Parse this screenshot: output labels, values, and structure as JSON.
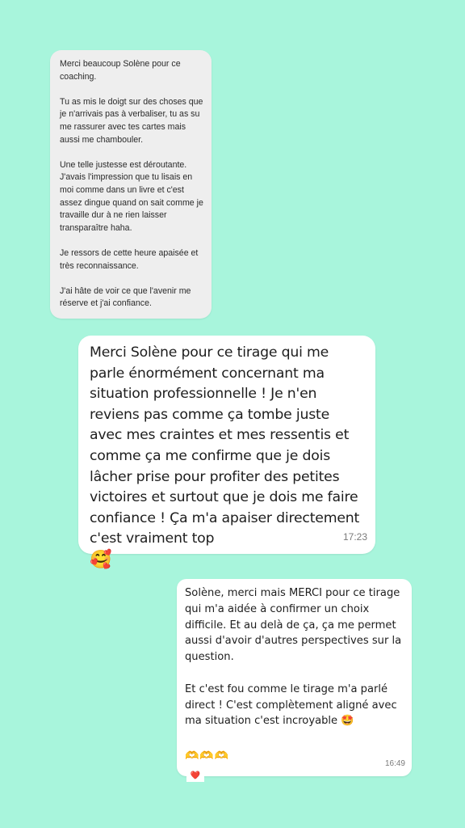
{
  "background_color": "#a8f5dc",
  "message1": {
    "paragraphs": [
      "Merci beaucoup Solène pour ce coaching.",
      "Tu as mis le doigt sur des choses que je n'arrivais pas à verbaliser, tu as su me rassurer avec tes cartes mais aussi me chambouler.",
      "Une telle justesse est déroutante. J'avais l'impression que tu lisais en moi comme dans un livre et c'est assez dingue quand on sait comme je travaille dur à ne rien laisser transparaître haha.",
      "Je ressors de cette heure apaisée et très reconnaissance.",
      "J'ai hâte de voir ce que l'avenir me réserve et j'ai confiance."
    ]
  },
  "message2": {
    "text": "Merci Solène pour ce tirage qui me parle énormément concernant ma situation professionnelle ! Je n'en reviens pas comme ça tombe juste avec mes craintes et mes ressentis et comme ça me confirme que je dois lâcher prise pour profiter des petites victoires et surtout que je dois me faire confiance ! Ça m'a apaiser directement c'est vraiment top",
    "emoji": "🥰",
    "time": "17:23"
  },
  "message3": {
    "paragraphs": [
      "Solène, merci mais MERCI pour ce tirage qui m'a aidée à confirmer un choix difficile. Et au delà de ça, ça me permet aussi d'avoir d'autres perspectives sur la question.",
      "Et c'est fou comme le tirage m'a parlé direct ! C'est complètement aligné avec ma situation c'est incroyable 🤩"
    ],
    "hearts": "🫶🫶🫶",
    "time": "16:49",
    "reaction": "❤️"
  }
}
